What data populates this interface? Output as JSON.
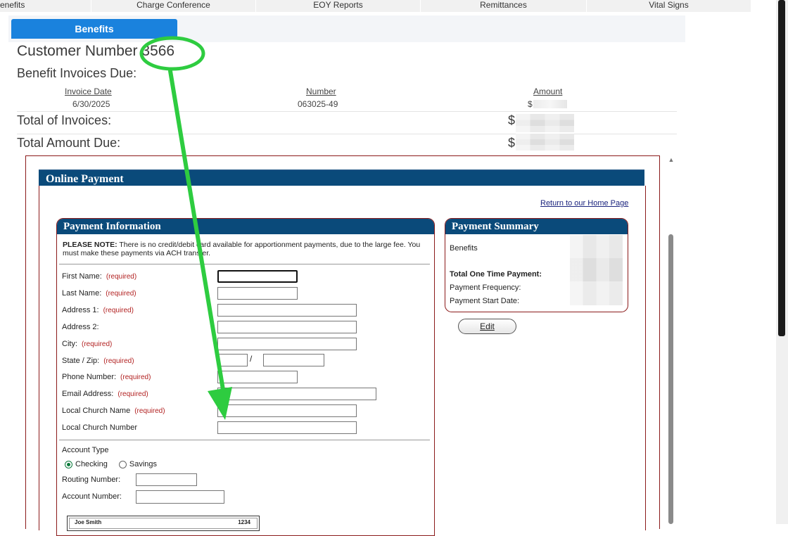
{
  "top_nav": {
    "tabs": [
      "enefits",
      "Charge Conference",
      "EOY Reports",
      "Remittances",
      "Vital Signs"
    ]
  },
  "sub_tab": {
    "label": "Benefits"
  },
  "customer": {
    "title_prefix": "Customer Number ",
    "number": "3566"
  },
  "invoices": {
    "heading": "Benefit Invoices Due:",
    "columns": {
      "date": "Invoice Date",
      "number": "Number",
      "amount": "Amount"
    },
    "rows": [
      {
        "date": "6/30/2025",
        "number": "063025-49",
        "amount_symbol": "$"
      }
    ],
    "total_invoices_label": "Total of Invoices:",
    "total_due_label": "Total Amount Due:",
    "currency_symbol": "$"
  },
  "online_payment": {
    "title": "Online Payment",
    "return_link": "Return to our Home Page",
    "payment_info": {
      "title": "Payment Information",
      "note_bold": "PLEASE NOTE:",
      "note_text": "  There is no credit/debit card available for apportionment payments, due to the large fee.  You must make these payments via ACH transfer.",
      "required_text": "(required)",
      "fields": {
        "first_name": "First Name:",
        "last_name": "Last Name:",
        "address1": "Address 1:",
        "address2": "Address 2:",
        "city": "City:",
        "state_zip": "State / Zip:",
        "phone": "Phone Number:",
        "email": "Email Address:",
        "church_name": "Local Church Name",
        "church_number": "Local Church Number"
      },
      "zip_separator": "/",
      "account_type_label": "Account Type",
      "account_types": [
        {
          "label": "Checking",
          "selected": true
        },
        {
          "label": "Savings",
          "selected": false
        }
      ],
      "routing_label": "Routing Number:",
      "account_label": "Account Number:",
      "check_sample": {
        "name": "Joe Smith",
        "number": "1234"
      }
    },
    "summary": {
      "title": "Payment Summary",
      "benefits": "Benefits",
      "total_one_time": "Total One Time Payment:",
      "frequency": "Payment Frequency:",
      "start_date": "Payment Start Date:",
      "edit_button": "Edit"
    }
  },
  "annotation": {
    "color": "#2ecc40"
  }
}
